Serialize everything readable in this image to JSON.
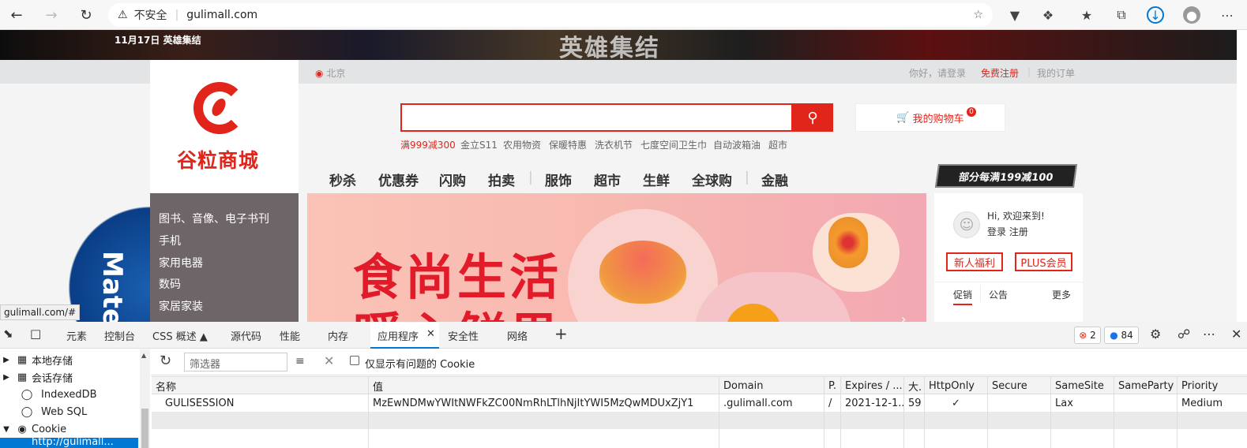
{
  "browser": {
    "url": "gulimall.com",
    "security_label": "不安全",
    "status_url": "gulimall.com/#"
  },
  "banner": {
    "date_text": "11月17日 英雄集结"
  },
  "topnav": {
    "location": "北京",
    "login": "你好，请登录",
    "register": "免费注册",
    "orders": "我的订单"
  },
  "site": {
    "logo_text": "谷粒商城",
    "cart_label": "我的购物车",
    "cart_count": "0",
    "hot_words": [
      "满999减300",
      "金立S11",
      "农用物资",
      "保暖特惠",
      "洗衣机节",
      "七度空间卫生巾",
      "自动波箱油",
      "超市"
    ],
    "nav": [
      "秒杀",
      "优惠券",
      "闪购",
      "拍卖",
      "服饰",
      "超市",
      "生鲜",
      "全球购",
      "金融"
    ],
    "promo": "部分每满199减100",
    "categories": [
      "图书、音像、电子书刊",
      "手机",
      "家用电器",
      "数码",
      "家居家装"
    ],
    "hero_line1": "食尚生活",
    "hero_line2": "暖心鲜果",
    "welcome": "Hi, 欢迎来到!",
    "login_register": "登录 注册",
    "btn_newuser": "新人福利",
    "btn_plus": "PLUS会员",
    "notice_tabs": [
      "促销",
      "公告",
      "更多"
    ]
  },
  "devtools": {
    "tabs": [
      "元素",
      "控制台",
      "CSS 概述",
      "源代码",
      "性能",
      "内存",
      "应用程序",
      "安全性",
      "网络"
    ],
    "errors": "2",
    "messages": "84",
    "tree": [
      "本地存储",
      "会话存储",
      "IndexedDB",
      "Web SQL",
      "Cookie",
      "http://gulimall..."
    ],
    "filter_placeholder": "筛选器",
    "only_issues": "仅显示有问题的 Cookie",
    "columns": [
      "名称",
      "值",
      "Domain",
      "P.",
      "Expires / ...",
      "大.",
      "HttpOnly",
      "Secure",
      "SameSite",
      "SameParty",
      "Priority"
    ],
    "row": [
      "GULISESSION",
      "MzEwNDMwYWItNWFkZC00NmRhLTlhNjItYWI5MzQwMDUxZjY1",
      ".gulimall.com",
      "/",
      "2021-12-1...",
      "59",
      "✓",
      "",
      "Lax",
      "",
      "Medium"
    ]
  },
  "colors": {
    "brand_red": "#e1251b",
    "accent_blue": "#0078d4"
  }
}
